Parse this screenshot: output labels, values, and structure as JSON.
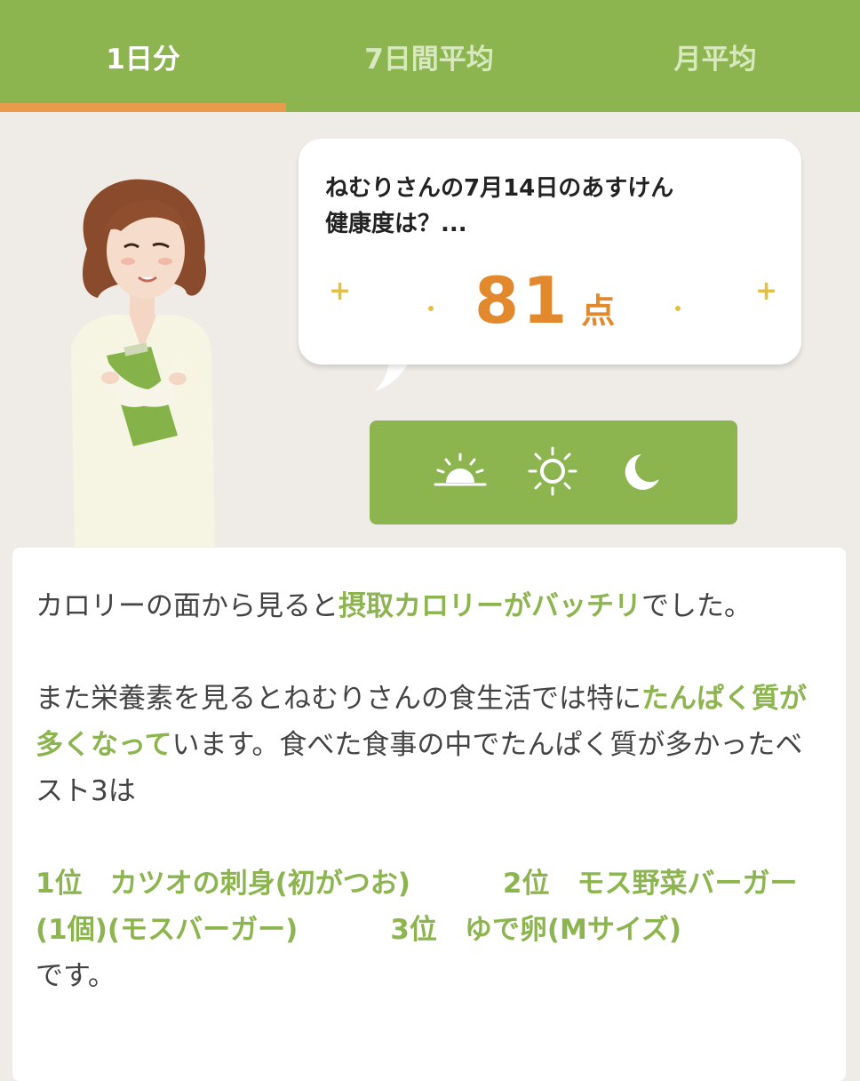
{
  "tabs": [
    {
      "label": "1日分",
      "active": true
    },
    {
      "label": "7日間平均",
      "active": false
    },
    {
      "label": "月平均",
      "active": false
    }
  ],
  "bubble": {
    "question_line1": "ねむりさんの7月14日のあすけん",
    "question_line2": "健康度は？...",
    "score": "81",
    "score_unit": "点"
  },
  "time_icons": [
    "sunrise-icon",
    "sun-icon",
    "moon-icon"
  ],
  "colors": {
    "accent": "#8cb550",
    "score": "#e2892e",
    "tab_indicator": "#e89b4a"
  },
  "comment": {
    "p1_a": "カロリーの面から見ると",
    "p1_hl": "摂取カロリーがバッチリ",
    "p1_b": "でした。",
    "p2_a": "また栄養素を見るとねむりさんの食生活では特に",
    "p2_hl": "たんぱく質が多くなって",
    "p2_b": "います。食べた食事の中でたんぱく質が多かったベスト3は",
    "rank1": "1位　カツオの刺身(初がつお)",
    "rank2": "2位　モス野菜バーガー(1個)(モスバーガー)",
    "rank3": "3位　ゆで卵(Mサイズ)",
    "p3_end": "です。"
  }
}
